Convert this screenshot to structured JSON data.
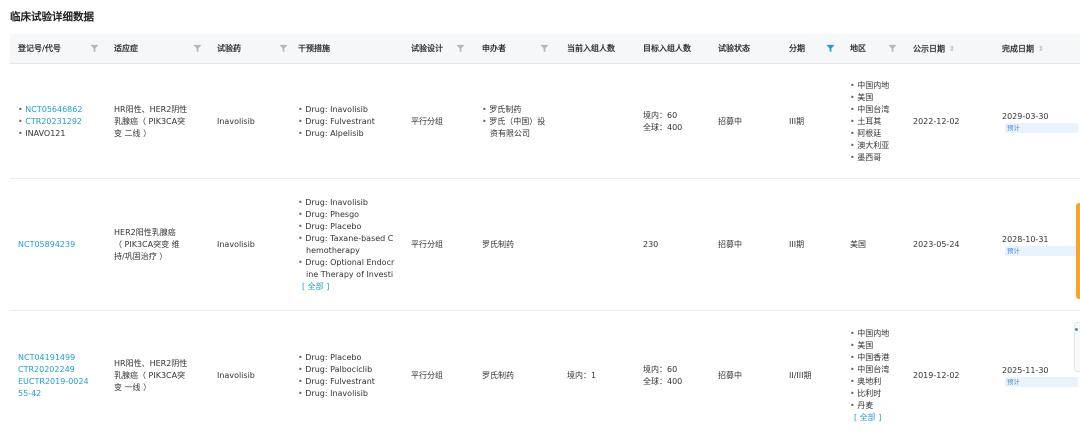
{
  "page": {
    "title": "临床试验详细数据"
  },
  "colors": {
    "accent": "#1e9fd6",
    "orange": "#f5a623"
  },
  "columns": [
    {
      "label": "登记号/代号",
      "filter": true
    },
    {
      "label": "适应症",
      "filter": true
    },
    {
      "label": "试验药",
      "filter": true
    },
    {
      "label": "干预措施",
      "filter": false
    },
    {
      "label": "试验设计",
      "filter": true
    },
    {
      "label": "申办者",
      "filter": true
    },
    {
      "label": "当前入组人数",
      "filter": false
    },
    {
      "label": "目标入组人数",
      "filter": false
    },
    {
      "label": "试验状态",
      "filter": false
    },
    {
      "label": "分期",
      "filter": true,
      "filter_active": true
    },
    {
      "label": "地区",
      "filter": true
    },
    {
      "label": "公示日期",
      "sort": true
    },
    {
      "label": "完成日期",
      "sort": true
    }
  ],
  "rows": [
    {
      "ids": [
        "NCT05646862",
        "CTR20231292",
        "INAVO121"
      ],
      "ids_link": [
        true,
        true,
        false
      ],
      "indication": [
        "HR阳性、HER2阴性",
        "乳腺癌（ PIK3CA突",
        "变  二线 ）"
      ],
      "drug": "Inavolisib",
      "interventions": [
        "Drug: Inavolisib",
        "Drug: Fulvestrant",
        "Drug: Alpelisib"
      ],
      "interventions_more": "",
      "design": "平行分组",
      "sponsor": [
        "罗氏制药",
        "罗氏（中国）投",
        "资有限公司"
      ],
      "current_enrollment": "",
      "target_enrollment": [
        "境内：60",
        "全球：400"
      ],
      "status": "招募中",
      "phase": "III期",
      "regions": [
        "中国内地",
        "美国",
        "中国台湾",
        "土耳其",
        "阿根廷",
        "澳大利亚",
        "墨西哥"
      ],
      "regions_more": "",
      "publish_date": "2022-12-02",
      "complete_date": "2029-03-30",
      "complete_tag": "预计"
    },
    {
      "ids": [
        "NCT05894239"
      ],
      "ids_link": [
        true
      ],
      "indication": [
        "HER2阳性乳腺癌",
        "（ PIK3CA突变  维",
        "持/巩固治疗 ）"
      ],
      "drug": "Inavolisib",
      "interventions": [
        "Drug: Inavolisib",
        "Drug: Phesgo",
        "Drug: Placebo",
        "Drug: Taxane-based C",
        "hemotherapy",
        "Drug: Optional Endocr",
        "ine Therapy of Investi"
      ],
      "interventions_more": "[ 全部 ]",
      "design": "平行分组",
      "sponsor": [
        "罗氏制药"
      ],
      "current_enrollment": "",
      "target_enrollment": [
        "230"
      ],
      "status": "招募中",
      "phase": "III期",
      "regions": [
        "美国"
      ],
      "regions_more": "",
      "publish_date": "2023-05-24",
      "complete_date": "2028-10-31",
      "complete_tag": "预计"
    },
    {
      "ids": [
        "NCT04191499",
        "CTR20202249",
        "EUCTR2019-0024",
        "55-42"
      ],
      "ids_link": [
        true,
        true,
        true,
        true
      ],
      "indication": [
        "HR阳性、HER2阴性",
        "乳腺癌（ PIK3CA突",
        "变  一线 ）"
      ],
      "drug": "Inavolisib",
      "interventions": [
        "Drug: Placebo",
        "Drug: Palbociclib",
        "Drug: Fulvestrant",
        "Drug: Inavolisib"
      ],
      "interventions_more": "",
      "design": "平行分组",
      "sponsor": [
        "罗氏制药"
      ],
      "current_enrollment": "境内：1",
      "target_enrollment": [
        "境内：60",
        "全球：400"
      ],
      "status": "招募中",
      "phase": "II/III期",
      "regions": [
        "中国内地",
        "美国",
        "中国香港",
        "中国台湾",
        "奥地利",
        "比利时",
        "丹麦"
      ],
      "regions_more": "[ 全部 ]",
      "publish_date": "2019-12-02",
      "complete_date": "2025-11-30",
      "complete_tag": "预计"
    }
  ]
}
